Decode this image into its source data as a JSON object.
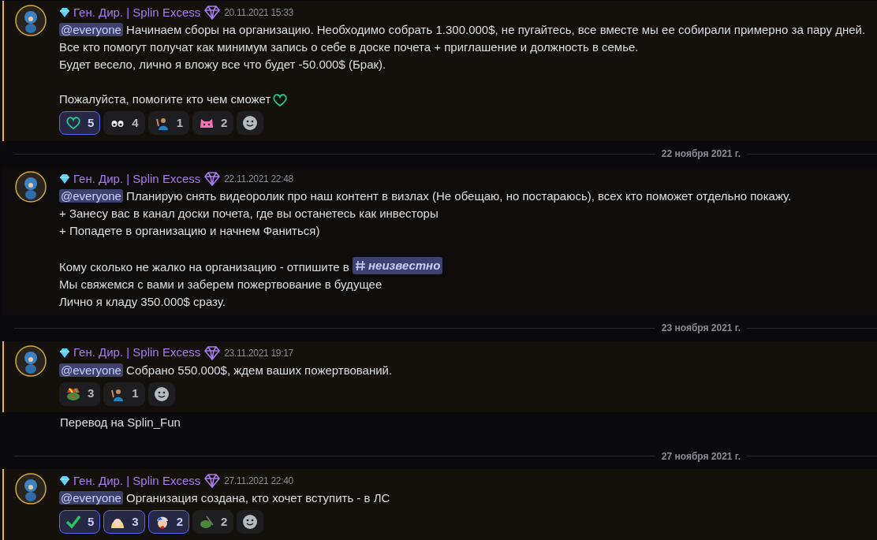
{
  "feed": [
    {
      "kind": "message",
      "highlighted": true,
      "author": "Ген. Дир. | Splin Excess",
      "time": "20.11.2021 15:33",
      "paragraphs": [
        {
          "lines": [
            [
              {
                "kind": "mention",
                "text": "@everyone"
              },
              {
                "kind": "text",
                "text": " Начинаем сборы на организацию. Необходимо собрать 1.300.000$, не пугайтесь, все вместе мы ее собирали примерно за пару дней."
              }
            ],
            [
              {
                "kind": "text",
                "text": "Все кто помогут получат как минимум запись о себе в доске почета + приглашение и должность в семье."
              }
            ],
            [
              {
                "kind": "text",
                "text": "Будет весело, лично я вложу все что будет -50.000$ (Брак)."
              }
            ]
          ]
        },
        {
          "lines": [
            [
              {
                "kind": "text",
                "text": "Пожалуйста, помогите кто чем сможет"
              },
              {
                "kind": "heart"
              }
            ]
          ]
        }
      ],
      "reactions": [
        {
          "kind": "heart",
          "count": "5",
          "selected": true
        },
        {
          "kind": "eyes",
          "count": "4",
          "selected": false
        },
        {
          "kind": "person",
          "count": "1",
          "selected": false
        },
        {
          "kind": "cat",
          "count": "2",
          "selected": false
        }
      ]
    },
    {
      "kind": "divider",
      "date": "22 ноября 2021 г."
    },
    {
      "kind": "message",
      "highlighted": false,
      "author": "Ген. Дир. | Splin Excess",
      "time": "22.11.2021 22:48",
      "paragraphs": [
        {
          "lines": [
            [
              {
                "kind": "mention",
                "text": "@everyone"
              },
              {
                "kind": "text",
                "text": " Планирую снять видеоролик про наш контент в визлах (Не обещаю, но постараюсь), всех кто поможет отдельно покажу."
              }
            ],
            [
              {
                "kind": "text",
                "text": "+ Занесу вас в канал доски почета, где вы останетесь как инвесторы"
              }
            ],
            [
              {
                "kind": "text",
                "text": "+ Попадете в организацию и начнем Фаниться)"
              }
            ]
          ]
        },
        {
          "lines": [
            [
              {
                "kind": "text",
                "text": "Кому сколько не жалко на организацию - отпишите в "
              },
              {
                "kind": "channel",
                "text": "неизвестно"
              }
            ],
            [
              {
                "kind": "text",
                "text": "Мы свяжемся с вами и заберем пожертвование в будущее"
              }
            ],
            [
              {
                "kind": "text",
                "text": "Лично я кладу 350.000$ сразу."
              }
            ]
          ]
        }
      ]
    },
    {
      "kind": "divider",
      "date": "23 ноября 2021 г."
    },
    {
      "kind": "message",
      "highlighted": true,
      "author": "Ген. Дир. | Splin Excess",
      "time": "23.11.2021 19:17",
      "paragraphs": [
        {
          "lines": [
            [
              {
                "kind": "mention",
                "text": "@everyone"
              },
              {
                "kind": "text",
                "text": " Собрано 550.000$, ждем ваших пожертвований."
              }
            ]
          ]
        }
      ],
      "reactions": [
        {
          "kind": "clown",
          "count": "3",
          "selected": false
        },
        {
          "kind": "person",
          "count": "1",
          "selected": false
        }
      ]
    },
    {
      "kind": "continuation",
      "text": "Перевод на Splin_Fun"
    },
    {
      "kind": "divider",
      "date": "27 ноября 2021 г."
    },
    {
      "kind": "message",
      "highlighted": true,
      "author": "Ген. Дир. | Splin Excess",
      "time": "27.11.2021 22:40",
      "paragraphs": [
        {
          "lines": [
            [
              {
                "kind": "mention",
                "text": "@everyone"
              },
              {
                "kind": "text",
                "text": " Организация создана, кто хочет вступить - в ЛС"
              }
            ]
          ]
        }
      ],
      "reactions": [
        {
          "kind": "check",
          "count": "5",
          "selected": true
        },
        {
          "kind": "girl",
          "count": "3",
          "selected": true
        },
        {
          "kind": "boy",
          "count": "2",
          "selected": true
        },
        {
          "kind": "frog",
          "count": "2",
          "selected": false
        }
      ]
    }
  ]
}
